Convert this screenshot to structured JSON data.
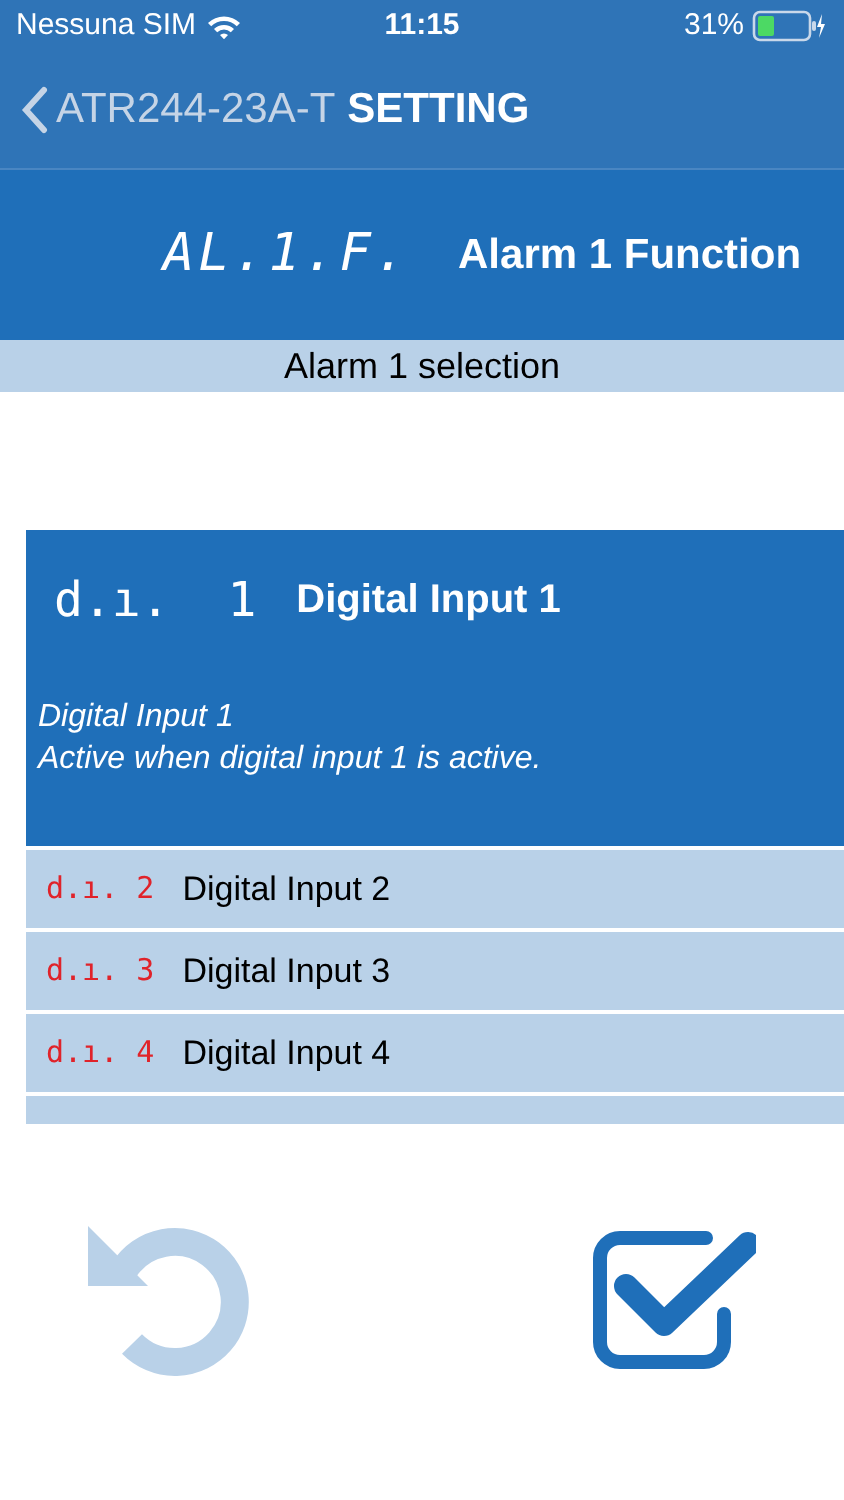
{
  "status_bar": {
    "carrier": "Nessuna SIM",
    "time": "11:15",
    "battery": "31%"
  },
  "nav": {
    "back_label": "ATR244-23A-T",
    "title": "SETTING"
  },
  "parameter": {
    "code": "AL.1.F.",
    "name": "Alarm 1 Function"
  },
  "section_title": "Alarm 1 selection",
  "options": [
    {
      "code": "d.ı.  1",
      "label": "Digital Input 1",
      "selected": true,
      "description": [
        "Digital Input 1",
        "Active when digital input 1 is active."
      ]
    },
    {
      "code": "d.ı. 2",
      "label": "Digital Input 2",
      "selected": false
    },
    {
      "code": "d.ı. 3",
      "label": "Digital Input 3",
      "selected": false
    },
    {
      "code": "d.ı. 4",
      "label": "Digital Input 4",
      "selected": false
    }
  ]
}
